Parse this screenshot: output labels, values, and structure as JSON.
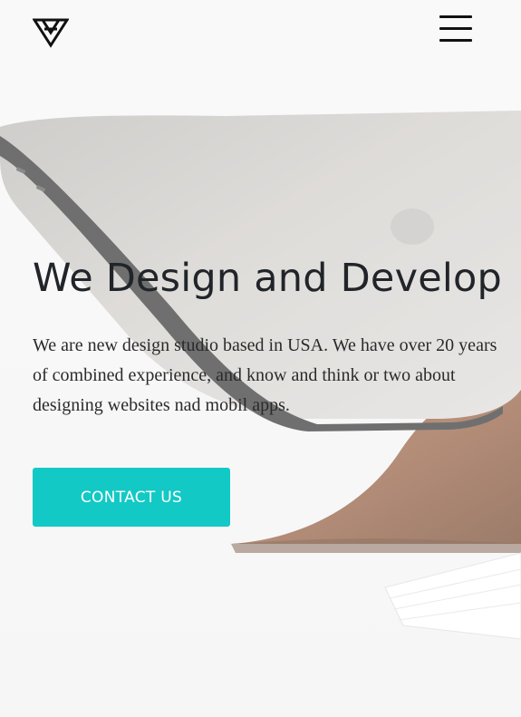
{
  "header": {
    "logo_icon": "triangle-logo-icon",
    "menu_icon": "hamburger-menu-icon"
  },
  "hero": {
    "title": "We Design and Develop",
    "description": "We are new design studio based in USA. We have over 20 years of combined experience, and know and think or two about designing websites nad mobil apps.",
    "cta_label": "CONTACT US",
    "background_image": "laptop-on-wooden-stand-photo"
  },
  "colors": {
    "accent": "#12c9c5",
    "heading": "#212529",
    "text": "#2a2a2a",
    "background": "#f4f4f4"
  }
}
